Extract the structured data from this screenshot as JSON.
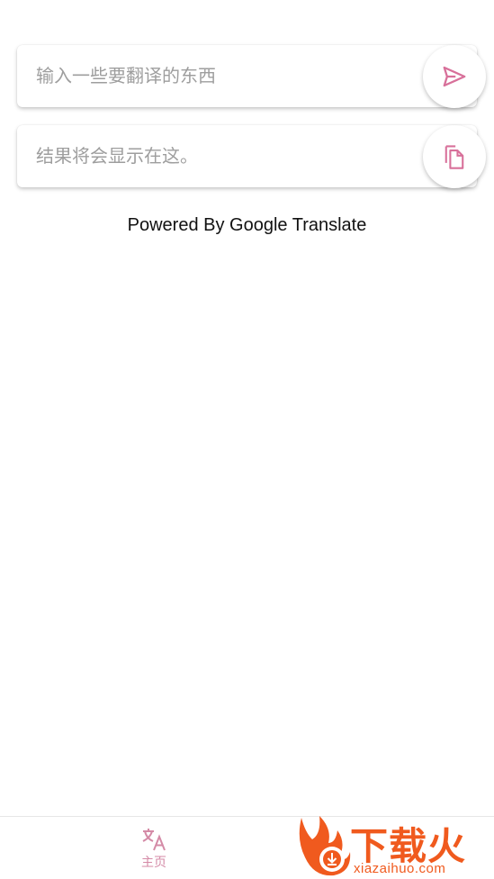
{
  "input": {
    "placeholder": "输入一些要翻译的东西",
    "send_icon": "send-icon"
  },
  "result": {
    "text": "结果将会显示在这。",
    "copy_icon": "copy-icon"
  },
  "footer_note": "Powered By Google Translate",
  "bottom_nav": {
    "items": [
      {
        "label": "主页",
        "icon": "translate-icon",
        "active": true
      }
    ]
  },
  "watermark": {
    "brand": "下载火",
    "site": "xiazaihuo.com"
  },
  "colors": {
    "accent": "#d8709a",
    "nav_accent": "#d48aa6",
    "watermark": "#f05a1e"
  }
}
